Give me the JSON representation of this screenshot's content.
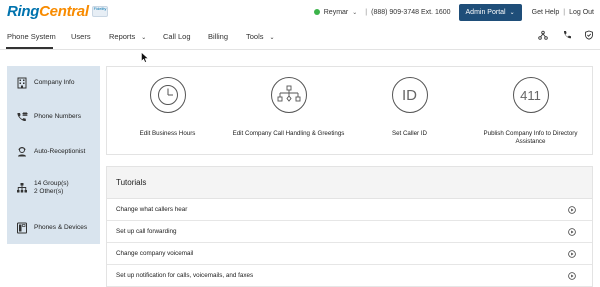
{
  "brand": {
    "logo_part1": "Ring",
    "logo_part2": "Central",
    "badge_text": "Fidelity",
    "logo_color": "#0073ae",
    "accent_color": "#f88b00"
  },
  "topbar": {
    "user_name": "Reymar",
    "phone": "(888) 909-3748 Ext. 1600",
    "admin_label": "Admin Portal",
    "help_label": "Get Help",
    "logout_label": "Log Out",
    "status_color": "#3bb34a"
  },
  "nav": {
    "items": [
      {
        "label": "Phone System"
      },
      {
        "label": "Users"
      },
      {
        "label": "Reports"
      },
      {
        "label": "Call Log"
      },
      {
        "label": "Billing"
      },
      {
        "label": "Tools"
      }
    ]
  },
  "sidebar": {
    "items": [
      {
        "label": "Company Info",
        "icon": "building-icon"
      },
      {
        "label": "Phone Numbers",
        "icon": "phone-icon"
      },
      {
        "label": "Auto-Receptionist",
        "icon": "receptionist-icon"
      },
      {
        "label_line1": "14 Group(s)",
        "label_line2": "2 Other(s)",
        "icon": "groups-icon"
      },
      {
        "label": "Phones & Devices",
        "icon": "devices-icon"
      }
    ]
  },
  "cards": [
    {
      "label": "Edit Business Hours",
      "icon": "clock-icon"
    },
    {
      "label": "Edit Company Call Handling & Greetings",
      "icon": "call-flow-icon"
    },
    {
      "label": "Set Caller ID",
      "icon_text": "ID"
    },
    {
      "label_line1": "Publish Company Info to Directory",
      "label_line2": "Assistance",
      "icon_text": "411"
    }
  ],
  "tutorials": {
    "title": "Tutorials",
    "rows": [
      {
        "label": "Change what callers hear"
      },
      {
        "label": "Set up call forwarding"
      },
      {
        "label": "Change company voicemail"
      },
      {
        "label": "Set up notification for calls, voicemails, and faxes"
      }
    ]
  }
}
